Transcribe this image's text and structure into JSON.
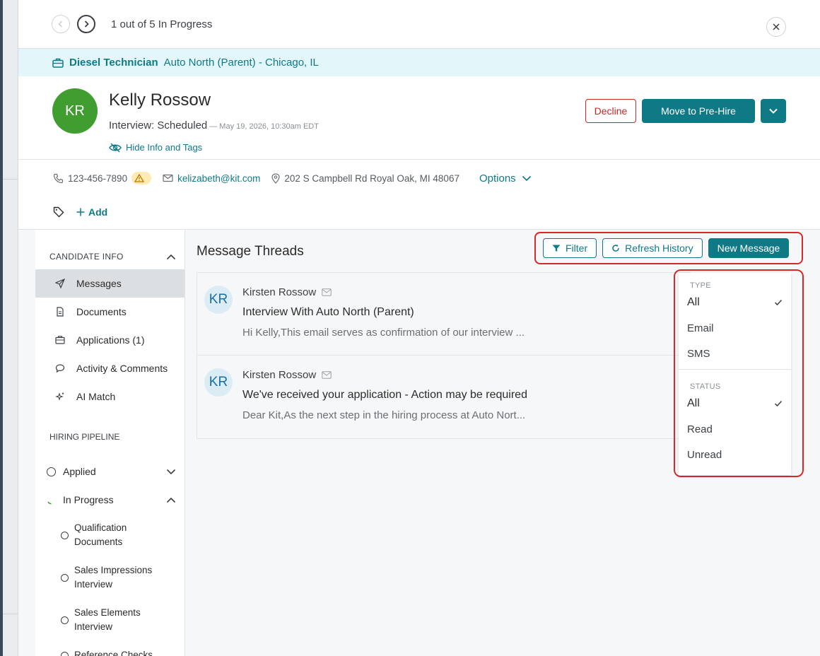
{
  "nav": {
    "counter_text": "1 out of 5 In Progress"
  },
  "job": {
    "title": "Diesel Technician",
    "location": "Auto North (Parent) - Chicago, IL"
  },
  "candidate": {
    "initials": "KR",
    "name": "Kelly Rossow",
    "status": "Interview: Scheduled",
    "status_date": "— May 19, 2026, 10:30am EDT",
    "hide_info_label": "Hide Info and Tags",
    "phone": "123-456-7890",
    "email": "kelizabeth@kit.com",
    "address": "202 S Campbell Rd Royal Oak, MI 48067",
    "options_label": "Options",
    "add_tag_label": "Add"
  },
  "actions": {
    "decline": "Decline",
    "move": "Move to Pre-Hire"
  },
  "sidebar": {
    "candidate_info_heading": "CANDIDATE INFO",
    "items": [
      {
        "label": "Messages",
        "icon": "send-icon"
      },
      {
        "label": "Documents",
        "icon": "document-icon"
      },
      {
        "label": "Applications (1)",
        "icon": "briefcase-icon"
      },
      {
        "label": "Activity & Comments",
        "icon": "comment-icon"
      },
      {
        "label": "AI Match",
        "icon": "sparkle-icon"
      }
    ],
    "pipeline_heading": "HIRING PIPELINE",
    "pipeline": [
      {
        "label": "Applied"
      },
      {
        "label": "In Progress"
      }
    ],
    "sub_steps": [
      {
        "line1": "Qualification",
        "line2": "Documents"
      },
      {
        "line1": "Sales Impressions",
        "line2": "Interview"
      },
      {
        "line1": "Sales Elements",
        "line2": "Interview"
      },
      {
        "line1": "Reference Checks",
        "line2": ""
      }
    ]
  },
  "main": {
    "title": "Message Threads",
    "filter_label": "Filter",
    "refresh_label": "Refresh History",
    "new_message_label": "New Message",
    "threads": [
      {
        "initials": "KR",
        "from": "Kirsten Rossow",
        "subject": "Interview With Auto North (Parent)",
        "preview": "Hi Kelly,This email serves as confirmation of our interview ..."
      },
      {
        "initials": "KR",
        "from": "Kirsten Rossow",
        "subject": "We've received your application - Action may be required",
        "preview": "Dear Kit,As the next step in the hiring process at Auto Nort..."
      }
    ]
  },
  "filter_dropdown": {
    "type_heading": "TYPE",
    "type_options": [
      "All",
      "Email",
      "SMS"
    ],
    "status_heading": "STATUS",
    "status_options": [
      "All",
      "Read",
      "Unread"
    ]
  },
  "colors": {
    "accent": "#0f7a85",
    "decline": "#c62828",
    "avatar": "#3f9e2f",
    "highlight": "#d62a2a"
  }
}
